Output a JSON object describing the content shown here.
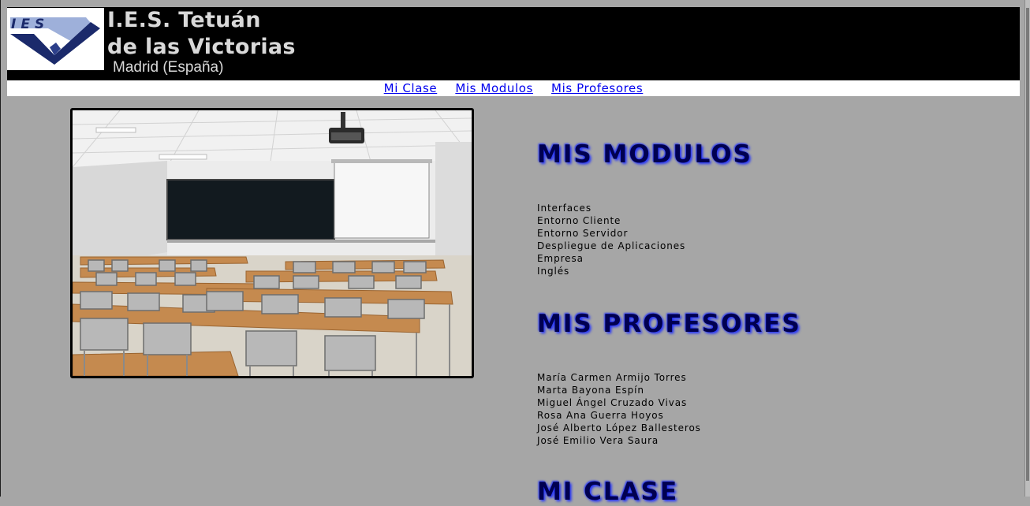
{
  "header": {
    "logo_text": "IES",
    "title_line1": "I.E.S. Tetuán",
    "title_line2": "de las Victorias",
    "subtitle": "Madrid (España)"
  },
  "nav": [
    {
      "label": "Mi Clase"
    },
    {
      "label": "Mis Modulos"
    },
    {
      "label": "Mis Profesores"
    }
  ],
  "modulos": {
    "heading": "MIS MODULOS",
    "items": [
      "Interfaces",
      "Entorno Cliente",
      "Entorno Servidor",
      "Despliegue de Aplicaciones",
      "Empresa",
      "Inglés"
    ]
  },
  "profesores": {
    "heading": "MIS PROFESORES",
    "items": [
      "María Carmen Armijo Torres",
      "Marta Bayona Espín",
      "Miguel Ángel Cruzado Vivas",
      "Rosa Ana Guerra Hoyos",
      "José Alberto López Ballesteros",
      "José Emilio Vera Saura"
    ]
  },
  "clase": {
    "heading": "MI CLASE"
  },
  "colors": {
    "page_bg": "#a6a6a6",
    "header_bg": "#000000",
    "title_text": "#d9d9d9",
    "link": "#0000ee",
    "heading": "#000050",
    "heading_glow": "#2030ff"
  }
}
